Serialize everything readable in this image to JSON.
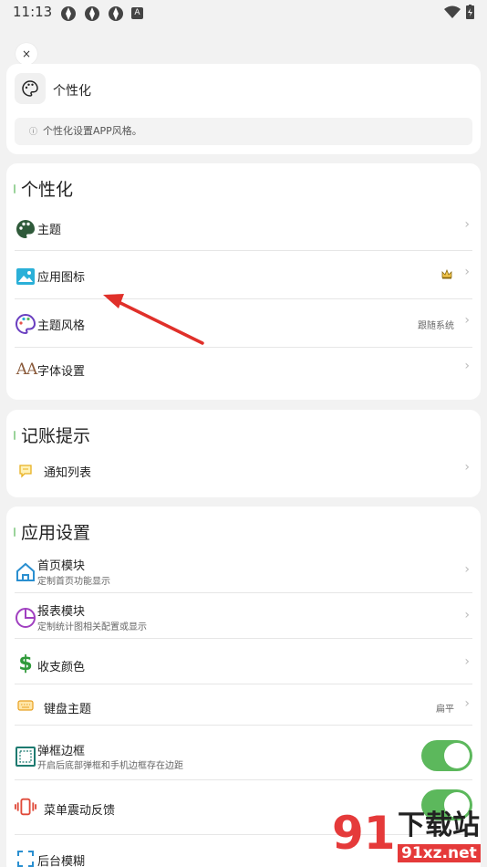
{
  "status_bar": {
    "time": "11:13",
    "letter_icon": "A"
  },
  "close_button": {
    "label": "×"
  },
  "header_card": {
    "title": "个性化",
    "hint": "个性化设置APP风格。",
    "hint_icon": "ⓘ"
  },
  "personalization": {
    "title": "个性化",
    "items": [
      {
        "label": "主题",
        "icon": "palette-icon"
      },
      {
        "label": "应用图标",
        "icon": "image-icon",
        "badge": "crown-icon"
      },
      {
        "label": "主题风格",
        "icon": "palette-outline-icon",
        "value": "跟随系统"
      },
      {
        "label": "字体设置",
        "icon": "font-size-icon",
        "icon_text": "AA"
      }
    ]
  },
  "bookkeeping": {
    "title": "记账提示",
    "items": [
      {
        "label": "通知列表",
        "icon": "chat-bubble-icon"
      }
    ]
  },
  "app_settings": {
    "title": "应用设置",
    "items": [
      {
        "label": "首页模块",
        "sub": "定制首页功能显示",
        "icon": "home-icon"
      },
      {
        "label": "报表模块",
        "sub": "定制统计图相关配置或显示",
        "icon": "pie-chart-icon"
      },
      {
        "label": "收支颜色",
        "icon": "dollar-icon",
        "icon_text": "$"
      },
      {
        "label": "键盘主题",
        "icon": "keyboard-icon",
        "value": "扁平"
      },
      {
        "label": "弹框边框",
        "sub": "开启后底部弹框和手机边框存在边距",
        "icon": "frame-icon",
        "toggle": true
      },
      {
        "label": "菜单震动反馈",
        "icon": "vibrate-icon",
        "toggle": true
      },
      {
        "label": "后台模糊",
        "icon": "blur-icon"
      }
    ]
  },
  "watermark": {
    "logo_text": "91",
    "text": "下载站",
    "url": "91xz.net"
  },
  "chevron": "›",
  "colors": {
    "accent_green": "#5cb85c",
    "arrow_red": "#e0302a",
    "background": "#f2f2f2"
  }
}
